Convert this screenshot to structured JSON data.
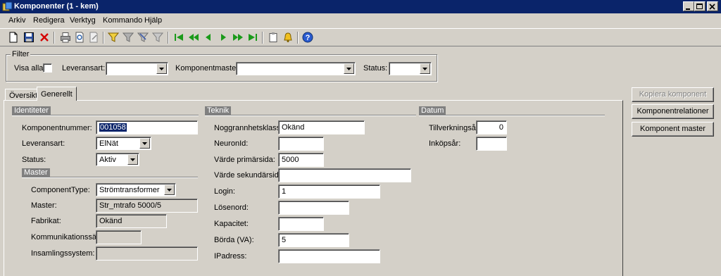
{
  "window": {
    "title": "Komponenter (1 - kem)"
  },
  "menu": [
    "Arkiv",
    "Redigera",
    "Verktyg",
    "Kommando",
    "Hjälp"
  ],
  "filter": {
    "legend": "Filter",
    "visa_alla_label": "Visa alla:",
    "visa_alla_checked": false,
    "leveransart_label": "Leveransart:",
    "leveransart_value": "",
    "komponentmaster_label": "Komponentmaster:",
    "komponentmaster_value": "",
    "status_label": "Status:",
    "status_value": ""
  },
  "tabs": [
    {
      "label": "Översikt",
      "active": false
    },
    {
      "label": "Generellt",
      "active": true
    }
  ],
  "identiteter": {
    "header": "Identiteter",
    "komponentnummer_label": "Komponentnummer:",
    "komponentnummer_value": "001058",
    "leveransart_label": "Leveransart:",
    "leveransart_value": "ElNät",
    "status_label": "Status:",
    "status_value": "Aktiv"
  },
  "master": {
    "header": "Master",
    "componenttype_label": "ComponentType:",
    "componenttype_value": "Strömtransformer",
    "master_label": "Master:",
    "master_value": "Str_mtrafo 5000/5",
    "fabrikat_label": "Fabrikat:",
    "fabrikat_value": "Okänd",
    "kommunikationssatt_label": "Kommunikationssätt:",
    "kommunikationssatt_value": "",
    "insamlingssystem_label": "Insamlingssystem:",
    "insamlingssystem_value": ""
  },
  "teknik": {
    "header": "Teknik",
    "noggrannhetsklass_label": "Noggrannhetsklass:",
    "noggrannhetsklass_value": "Okänd",
    "neuronid_label": "NeuronId:",
    "neuronid_value": "",
    "varde_primarsida_label": "Värde primärsida:",
    "varde_primarsida_value": "5000",
    "varde_sekundarsida_label": "Värde sekundärsida:",
    "varde_sekundarsida_value": "",
    "login_label": "Login:",
    "login_value": "1",
    "losenord_label": "Lösenord:",
    "losenord_value": "",
    "kapacitet_label": "Kapacitet:",
    "kapacitet_value": "",
    "borda_label": "Börda (VA):",
    "borda_value": "5",
    "ipadress_label": "IPadress:",
    "ipadress_value": ""
  },
  "datum": {
    "header": "Datum",
    "tillverkningsar_label": "Tillverkningsår:",
    "tillverkningsar_value": "0",
    "inkopsar_label": "Inköpsår:",
    "inkopsar_value": ""
  },
  "actions": {
    "kopiera": "Kopiera komponent",
    "komponentrelationer": "Komponentrelationer",
    "komponent_master": "Komponent master"
  },
  "colors": {
    "titlebar": "#0a246a",
    "face": "#d4d0c8",
    "selection": "#0a246a"
  }
}
